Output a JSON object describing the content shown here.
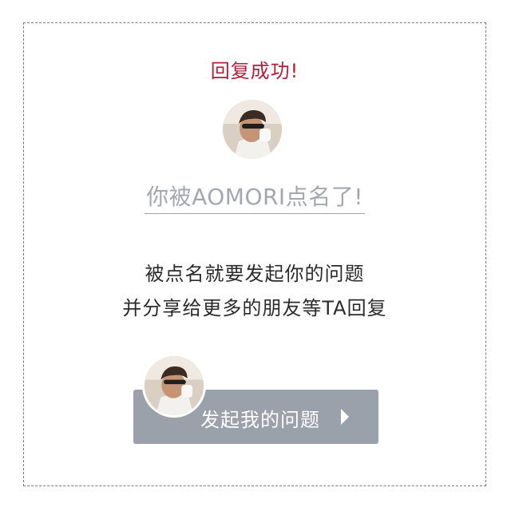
{
  "header": {
    "success_title": "回复成功!"
  },
  "avatar_top": {
    "icon": "user-avatar-icon"
  },
  "named": {
    "text": "你被AOMORI点名了!"
  },
  "description": {
    "line1": "被点名就要发起你的问题",
    "line2": "并分享给更多的朋友等TA回复"
  },
  "action": {
    "button_label": "发起我的问题",
    "icon": "play-icon"
  },
  "colors": {
    "accent_red": "#b1203a",
    "button_gray": "#9aa1ab",
    "muted_text": "#a3a8b0"
  }
}
